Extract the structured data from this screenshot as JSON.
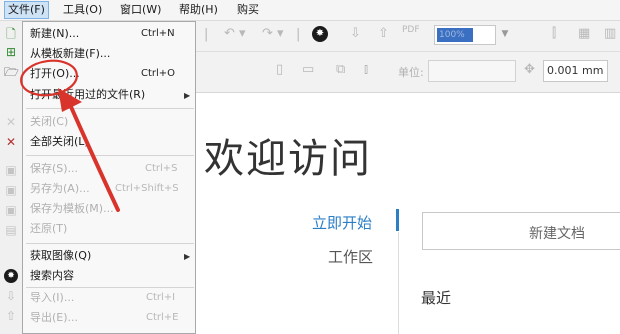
{
  "menubar": {
    "items": [
      {
        "label": "文件(F)"
      },
      {
        "label": "工具(O)"
      },
      {
        "label": "窗口(W)"
      },
      {
        "label": "帮助(H)"
      },
      {
        "label": "购买"
      }
    ]
  },
  "toolbar": {
    "zoom_value": "100%",
    "unit_label": "单位:",
    "nudge_value": "0.001 mm"
  },
  "file_menu": {
    "items": [
      {
        "label": "新建(N)...",
        "shortcut": "Ctrl+N",
        "enabled": true
      },
      {
        "label": "从模板新建(F)...",
        "shortcut": "",
        "enabled": true
      },
      {
        "label": "打开(O)...",
        "shortcut": "Ctrl+O",
        "enabled": true
      },
      {
        "label": "打开最近用过的文件(R)",
        "shortcut": "",
        "enabled": true,
        "submenu": true
      },
      {
        "label": "关闭(C)",
        "shortcut": "",
        "enabled": false
      },
      {
        "label": "全部关闭(L)",
        "shortcut": "",
        "enabled": true
      },
      {
        "label": "保存(S)...",
        "shortcut": "Ctrl+S",
        "enabled": false
      },
      {
        "label": "另存为(A)...",
        "shortcut": "Ctrl+Shift+S",
        "enabled": false
      },
      {
        "label": "保存为模板(M)...",
        "shortcut": "",
        "enabled": false
      },
      {
        "label": "还原(T)",
        "shortcut": "",
        "enabled": false
      },
      {
        "label": "获取图像(Q)",
        "shortcut": "",
        "enabled": true,
        "submenu": true
      },
      {
        "label": "搜索内容",
        "shortcut": "",
        "enabled": true
      },
      {
        "label": "导入(I)...",
        "shortcut": "Ctrl+I",
        "enabled": false
      },
      {
        "label": "导出(E)...",
        "shortcut": "Ctrl+E",
        "enabled": false
      }
    ]
  },
  "welcome": {
    "title": "欢迎访问",
    "start_label": "立即开始",
    "workspace_label": "工作区",
    "new_doc_label": "新建文档",
    "recent_label": "最近"
  },
  "colors": {
    "accent": "#2a7fc7",
    "annotation": "#d9342b",
    "menu_highlight": "#cfe3f7"
  }
}
